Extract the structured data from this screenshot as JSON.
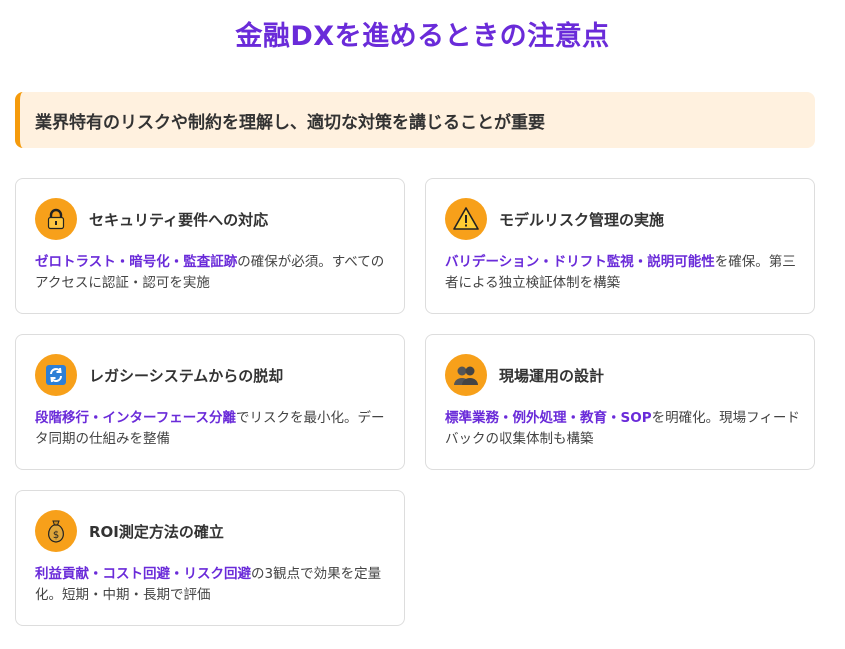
{
  "title": "金融DXを進めるときの注意点",
  "banner": "業界特有のリスクや制約を理解し、適切な対策を講じることが重要",
  "cards": [
    {
      "icon": "lock-icon",
      "title": "セキュリティ要件への対応",
      "highlight": "ゼロトラスト・暗号化・監査証跡",
      "text": "の確保が必須。すべてのアクセスに認証・認可を実施"
    },
    {
      "icon": "warning-icon",
      "title": "モデルリスク管理の実施",
      "highlight": "バリデーション・ドリフト監視・説明可能性",
      "text": "を確保。第三者による独立検証体制を構築"
    },
    {
      "icon": "refresh-icon",
      "title": "レガシーシステムからの脱却",
      "highlight": "段階移行・インターフェース分離",
      "text": "でリスクを最小化。データ同期の仕組みを整備"
    },
    {
      "icon": "people-icon",
      "title": "現場運用の設計",
      "highlight": "標準業務・例外処理・教育・SOP",
      "text": "を明確化。現場フィードバックの収集体制も構築"
    },
    {
      "icon": "money-bag-icon",
      "title": "ROI測定方法の確立",
      "highlight": "利益貢献・コスト回避・リスク回避",
      "text": "の3観点で効果を定量化。短期・中期・長期で評価"
    }
  ],
  "colors": {
    "accent": "#6a2bd9",
    "orange": "#f7a01a",
    "banner_bg": "#fff1df",
    "banner_border": "#f59b0c"
  }
}
